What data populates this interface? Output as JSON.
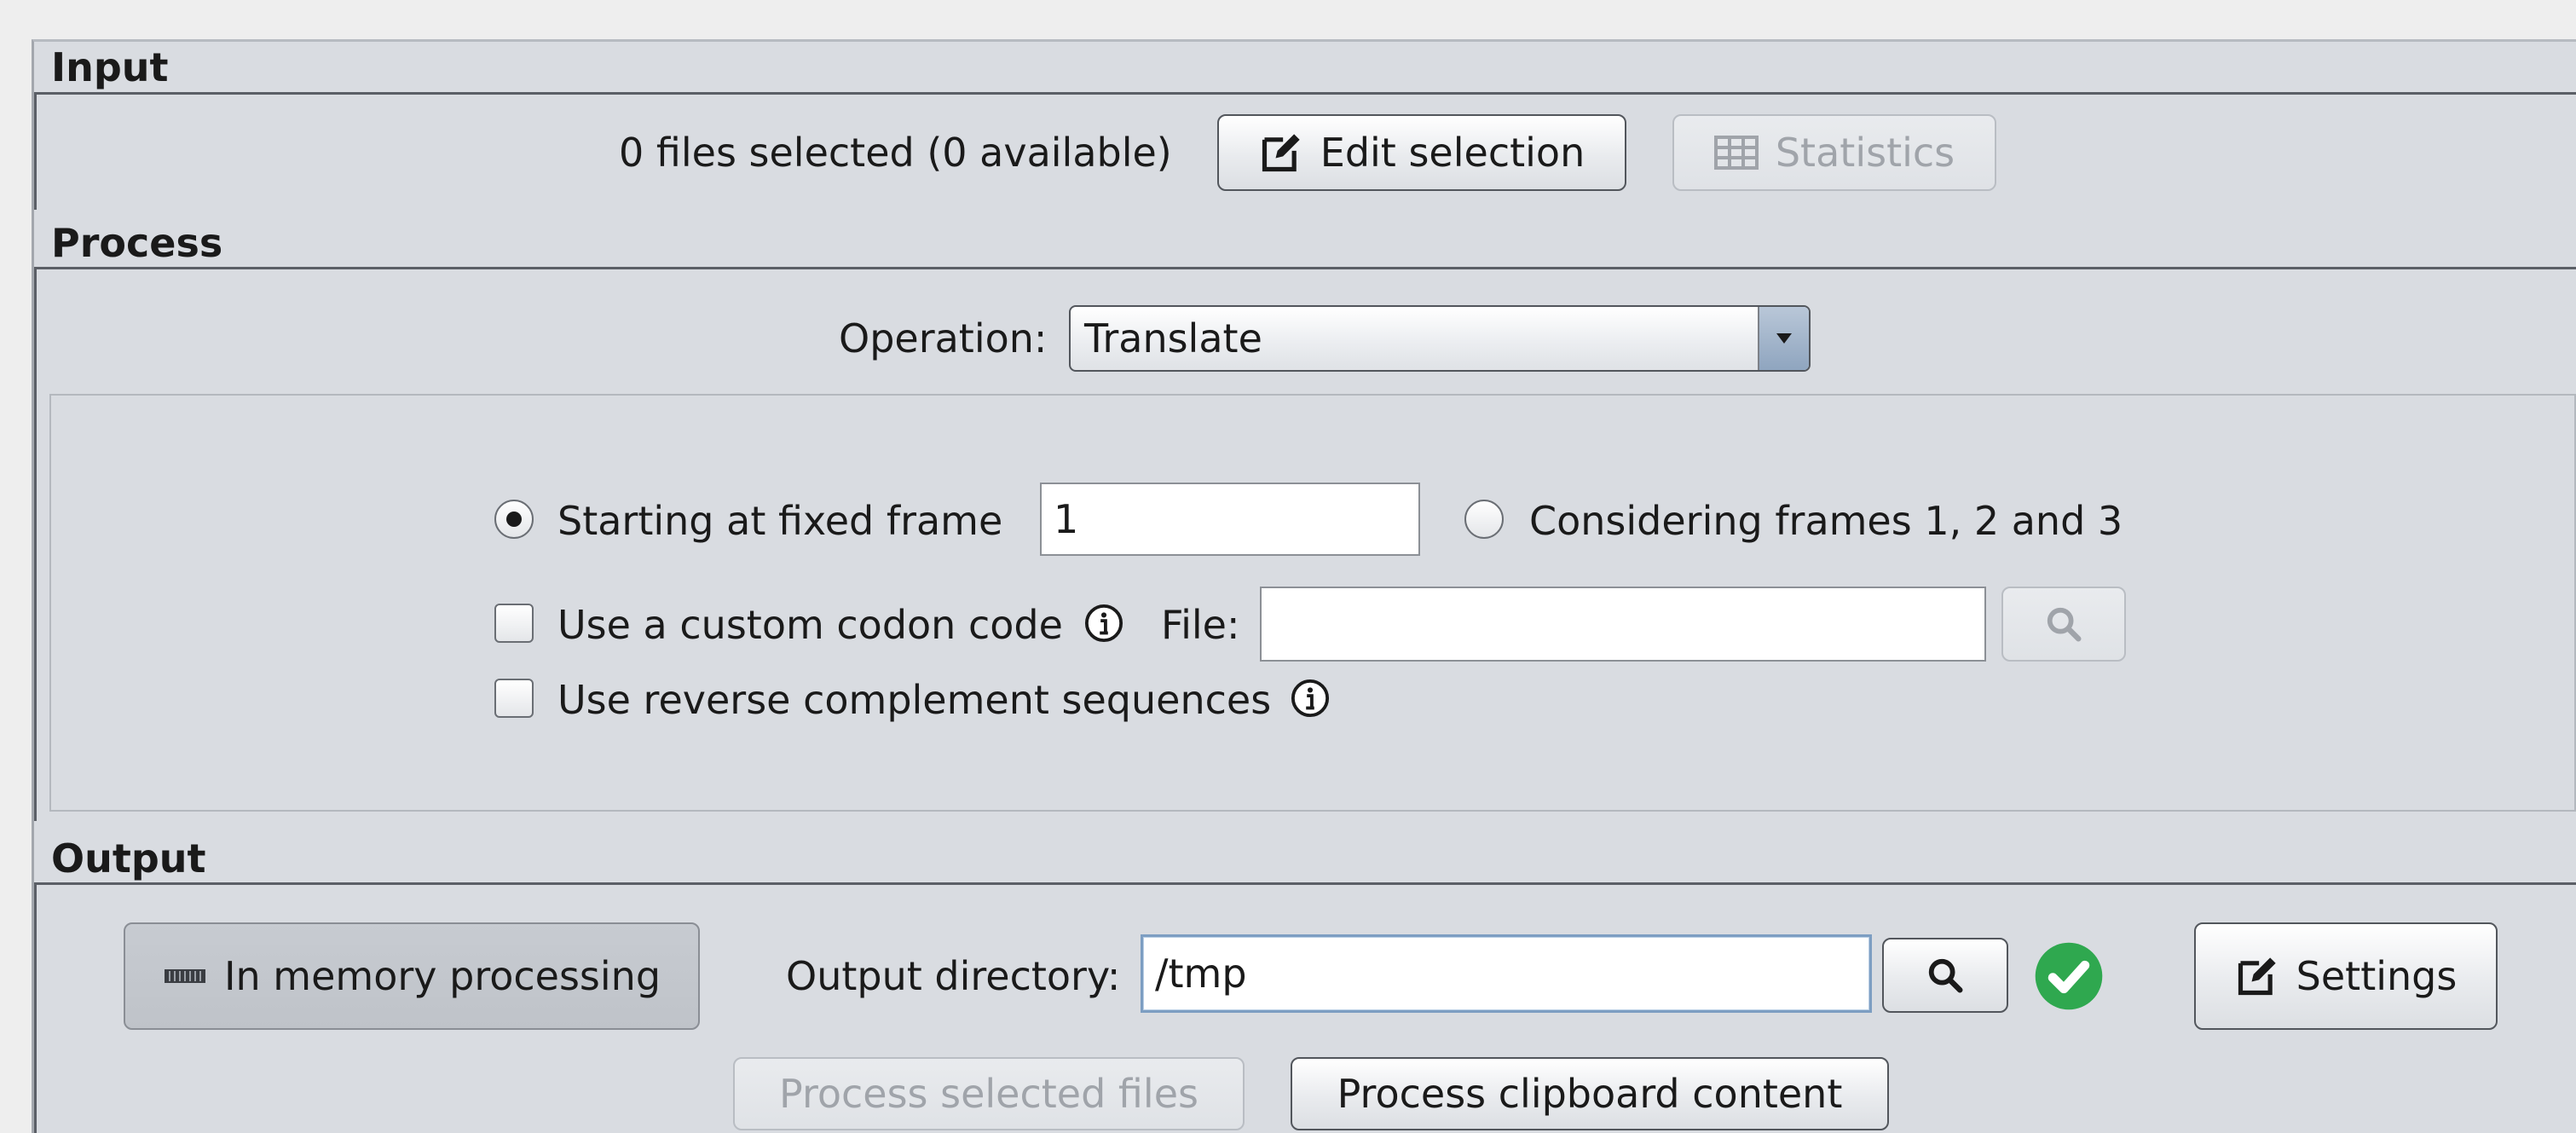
{
  "input": {
    "title": "Input",
    "files_status": "0 files selected (0 available)",
    "edit_selection_label": "Edit selection",
    "statistics_label": "Statistics"
  },
  "process": {
    "title": "Process",
    "operation_label": "Operation:",
    "operation_value": "Translate",
    "fixed_frame_label": "Starting at fixed frame",
    "fixed_frame_value": "1",
    "fixed_frame_selected": true,
    "all_frames_label": "Considering frames 1, 2 and 3",
    "custom_codon_label": "Use a custom codon code",
    "custom_codon_checked": false,
    "file_label": "File:",
    "file_value": "",
    "reverse_complement_label": "Use reverse complement sequences",
    "reverse_complement_checked": false
  },
  "output": {
    "title": "Output",
    "in_memory_label": "In memory processing",
    "output_directory_label": "Output directory:",
    "output_directory_value": "/tmp",
    "settings_label": "Settings",
    "process_selected_label": "Process selected files",
    "process_clipboard_label": "Process clipboard content"
  },
  "colors": {
    "panel_bg": "#d9dce1",
    "valid_green": "#2fa84f",
    "disabled_text": "#a0a4aa"
  },
  "icons": [
    "edit-icon",
    "table-icon",
    "dropdown-arrow-icon",
    "info-icon",
    "search-icon",
    "memory-icon",
    "check-circle-icon"
  ]
}
